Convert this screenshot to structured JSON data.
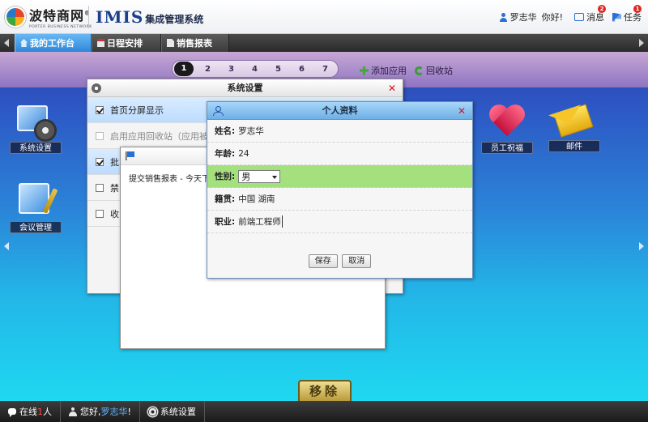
{
  "header": {
    "logo_cn": "波特商网",
    "logo_en": "PORTER BUSINESS NETWORK",
    "logo_reg": "®",
    "app_title_en": "IMIS",
    "app_title_cn": "集成管理系统",
    "user_name": "罗志华",
    "greeting": "你好!",
    "messages_label": "消息",
    "messages_count": "2",
    "tasks_label": "任务",
    "tasks_count": "1"
  },
  "tabs": [
    {
      "label": "我的工作台",
      "icon": "home-icon",
      "active": true
    },
    {
      "label": "日程安排",
      "icon": "calendar-icon",
      "active": false
    },
    {
      "label": "销售报表",
      "icon": "document-icon",
      "active": false
    }
  ],
  "toolbar": {
    "pages": [
      "1",
      "2",
      "3",
      "4",
      "5",
      "6",
      "7"
    ],
    "current_page": "1",
    "add_app_label": "添加应用",
    "recycle_label": "回收站"
  },
  "desktop_apps": [
    {
      "label": "系统设置",
      "icon": "system-settings-icon"
    },
    {
      "label": "会议管理",
      "icon": "meeting-management-icon"
    },
    {
      "label": "员工祝福",
      "icon": "heart-gift-icon"
    },
    {
      "label": "邮件",
      "icon": "mail-icon"
    }
  ],
  "settings_window": {
    "title": "系统设置",
    "rows": [
      {
        "label": "首页分屏显示",
        "checked": true,
        "highlighted": true
      },
      {
        "label": "启用应用回收站（应用被移除",
        "checked": false,
        "disabled": true
      },
      {
        "label": "批",
        "checked": true,
        "highlighted": true
      },
      {
        "label": "禁",
        "checked": false
      },
      {
        "label": "收",
        "checked": false
      }
    ]
  },
  "report_window": {
    "text": "提交销售报表 - 今天下"
  },
  "profile_window": {
    "title": "个人资料",
    "name_label": "姓名:",
    "name_value": "罗志华",
    "age_label": "年龄:",
    "age_value": "24",
    "gender_label": "性别:",
    "gender_value": "男",
    "hometown_label": "籍贯:",
    "hometown_value": "中国 湖南",
    "job_label": "职业:",
    "job_value": "前端工程师",
    "save_label": "保存",
    "cancel_label": "取消"
  },
  "remove_label": "移除",
  "bottom_bar": {
    "online_prefix": "在线",
    "online_count": "1",
    "online_suffix": "人",
    "hello_prefix": "您好,",
    "hello_name": "罗志华",
    "hello_suffix": "!",
    "settings_label": "系统设置"
  },
  "colors": {
    "active_tab": "#2e87d8",
    "highlight_row": "#a4e07e",
    "badge": "#e0261d",
    "close": "#d8121b"
  }
}
